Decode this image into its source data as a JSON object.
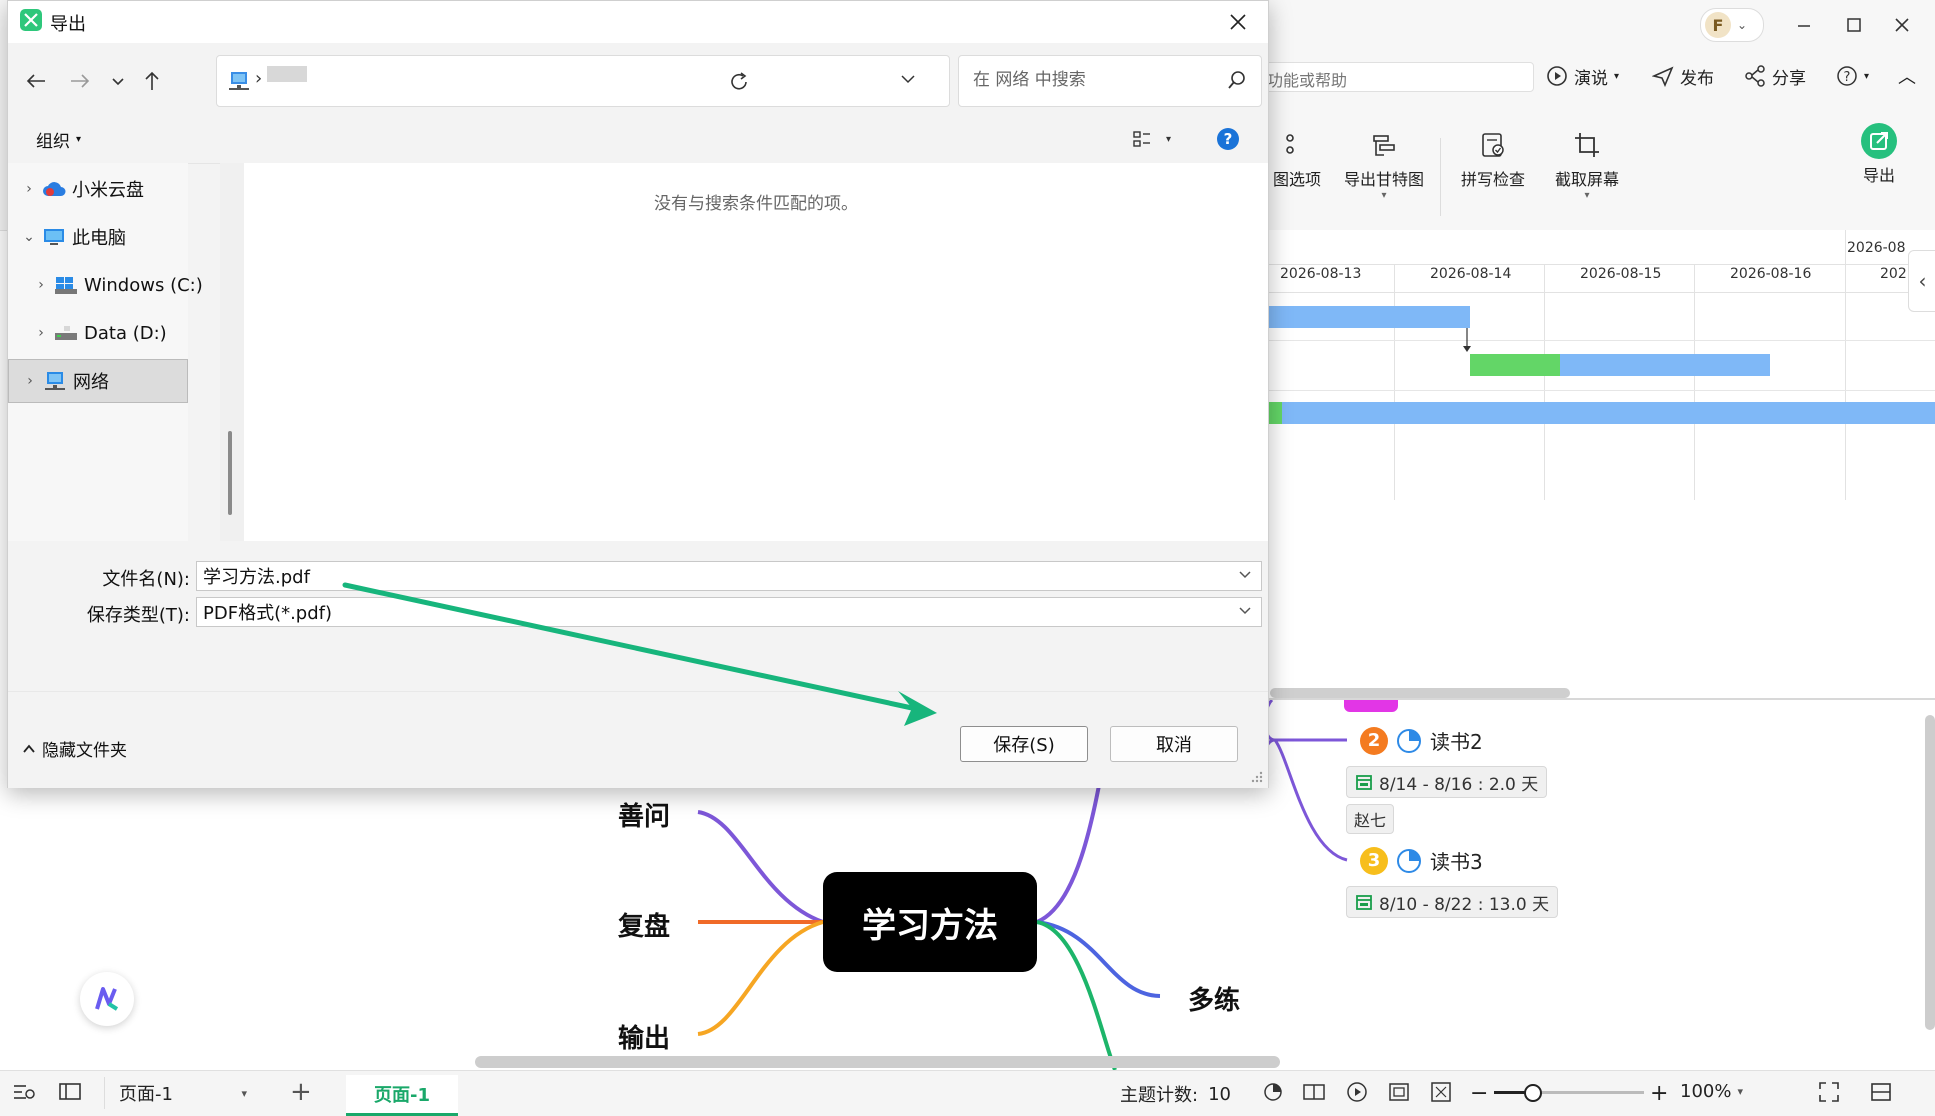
{
  "app": {
    "avatar_letter": "F",
    "search_placeholder": "功能或帮助",
    "top_actions": [
      {
        "label": "演说",
        "icon": "play-circle-icon"
      },
      {
        "label": "发布",
        "icon": "send-icon"
      },
      {
        "label": "分享",
        "icon": "share-icon"
      }
    ],
    "tools": [
      {
        "label": "图选项"
      },
      {
        "label": "导出甘特图"
      },
      {
        "label": "拼写检查"
      },
      {
        "label": "截取屏幕"
      },
      {
        "label": "导出"
      }
    ]
  },
  "gantt": {
    "header_top": "2026-08",
    "dates": [
      "2026-08-13",
      "2026-08-14",
      "2026-08-15",
      "2026-08-16",
      "202"
    ],
    "colors": {
      "planned": "#7fb8f7",
      "done": "#63d667"
    }
  },
  "mindmap": {
    "central": "学习方法",
    "left_branches": [
      "善问",
      "复盘",
      "输出"
    ],
    "right_branch": "多练",
    "tasks": [
      {
        "num": "2",
        "label": "读书2",
        "dates": "8/14 - 8/16 : 2.0 天",
        "person": "赵七",
        "color": "#f47b20"
      },
      {
        "num": "3",
        "label": "读书3",
        "dates": "8/10 - 8/22 : 13.0 天",
        "color": "#f7be1c"
      }
    ]
  },
  "statusbar": {
    "page_select": "页面-1",
    "active_tab": "页面-1",
    "topic_count_label": "主题计数:",
    "topic_count": "10",
    "zoom": "100%"
  },
  "dialog": {
    "title": "导出",
    "search_placeholder": "在 网络 中搜索",
    "organize": "组织",
    "empty_message": "没有与搜索条件匹配的项。",
    "tree": [
      {
        "label": "小米云盘"
      },
      {
        "label": "此电脑"
      },
      {
        "label": "Windows (C:)"
      },
      {
        "label": "Data (D:)"
      },
      {
        "label": "网络"
      }
    ],
    "filename_label": "文件名(N):",
    "filename": "学习方法.pdf",
    "filetype_label": "保存类型(T):",
    "filetype": "PDF格式(*.pdf)",
    "hide_folders": "隐藏文件夹",
    "save": "保存(S)",
    "cancel": "取消"
  },
  "annotation": {
    "arrow_color": "#17b57c"
  }
}
